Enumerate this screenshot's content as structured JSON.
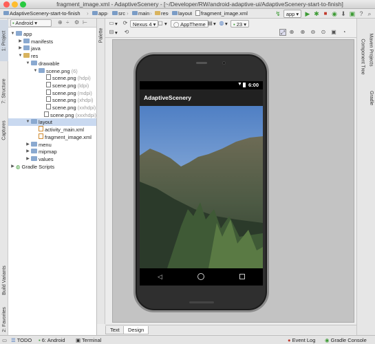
{
  "window": {
    "title": "fragment_image.xml - AdaptiveScenery - [~/Developer/RW/android-adaptive-ui/AdaptiveScenery-start-to-finish]"
  },
  "breadcrumbs": [
    "AdaptiveScenery-start-to-finish",
    "app",
    "src",
    "main",
    "res",
    "layout",
    "fragment_image.xml"
  ],
  "toolbar": {
    "run_config": "app"
  },
  "left_tabs": [
    "1: Project",
    "7: Structure",
    "Captures",
    "Build Variants",
    "2: Favorites"
  ],
  "project": {
    "view_selector": "Android",
    "tree": [
      {
        "label": "app",
        "suffix": "",
        "depth": 0,
        "icon": "folder-icon",
        "expanded": true
      },
      {
        "label": "manifests",
        "suffix": "",
        "depth": 1,
        "icon": "folder-icon",
        "expanded": false
      },
      {
        "label": "java",
        "suffix": "",
        "depth": 1,
        "icon": "folder-icon",
        "expanded": false
      },
      {
        "label": "res",
        "suffix": "",
        "depth": 1,
        "icon": "res-folder-icon",
        "expanded": true
      },
      {
        "label": "drawable",
        "suffix": "",
        "depth": 2,
        "icon": "folder-icon",
        "expanded": true
      },
      {
        "label": "scene.png",
        "suffix": "(6)",
        "depth": 3,
        "icon": "folder-icon",
        "expanded": true
      },
      {
        "label": "scene.png",
        "suffix": "(hdpi)",
        "depth": 4,
        "icon": "image-file-icon"
      },
      {
        "label": "scene.png",
        "suffix": "(ldpi)",
        "depth": 4,
        "icon": "image-file-icon"
      },
      {
        "label": "scene.png",
        "suffix": "(mdpi)",
        "depth": 4,
        "icon": "image-file-icon"
      },
      {
        "label": "scene.png",
        "suffix": "(xhdpi)",
        "depth": 4,
        "icon": "image-file-icon"
      },
      {
        "label": "scene.png",
        "suffix": "(xxhdpi)",
        "depth": 4,
        "icon": "image-file-icon"
      },
      {
        "label": "scene.png",
        "suffix": "(xxxhdpi)",
        "depth": 4,
        "icon": "image-file-icon"
      },
      {
        "label": "layout",
        "suffix": "",
        "depth": 2,
        "icon": "folder-icon",
        "expanded": true,
        "selected": true
      },
      {
        "label": "activity_main.xml",
        "suffix": "",
        "depth": 3,
        "icon": "xml-file-icon"
      },
      {
        "label": "fragment_image.xml",
        "suffix": "",
        "depth": 3,
        "icon": "xml-file-icon"
      },
      {
        "label": "menu",
        "suffix": "",
        "depth": 2,
        "icon": "folder-icon",
        "expanded": false
      },
      {
        "label": "mipmap",
        "suffix": "",
        "depth": 2,
        "icon": "folder-icon",
        "expanded": false
      },
      {
        "label": "values",
        "suffix": "",
        "depth": 2,
        "icon": "folder-icon",
        "expanded": false
      },
      {
        "label": "Gradle Scripts",
        "suffix": "",
        "depth": 0,
        "icon": "gradle-icon",
        "expanded": false
      }
    ]
  },
  "palette_tab": "Palette",
  "editor_toolbar": {
    "device": "Nexus 4",
    "theme": "AppTheme",
    "api_level": "23"
  },
  "device_preview": {
    "status_time": "6:00",
    "app_title": "AdaptiveScenery"
  },
  "editor_tabs": [
    "Text",
    "Design"
  ],
  "active_editor_tab": "Design",
  "right_tabs": [
    "Maven Projects",
    "Component Tree",
    "Gradle"
  ],
  "statusbar": {
    "todo": "TODO",
    "android": "6: Android",
    "terminal": "Terminal",
    "event_log": "Event Log",
    "gradle_console": "Gradle Console"
  },
  "colors": {
    "selection": "#c9d9f0",
    "app_bar": "#212121",
    "run_green": "#3d9b35",
    "close_red": "#ff5f57",
    "min_yellow": "#ffbd2e",
    "max_green": "#28c940"
  }
}
